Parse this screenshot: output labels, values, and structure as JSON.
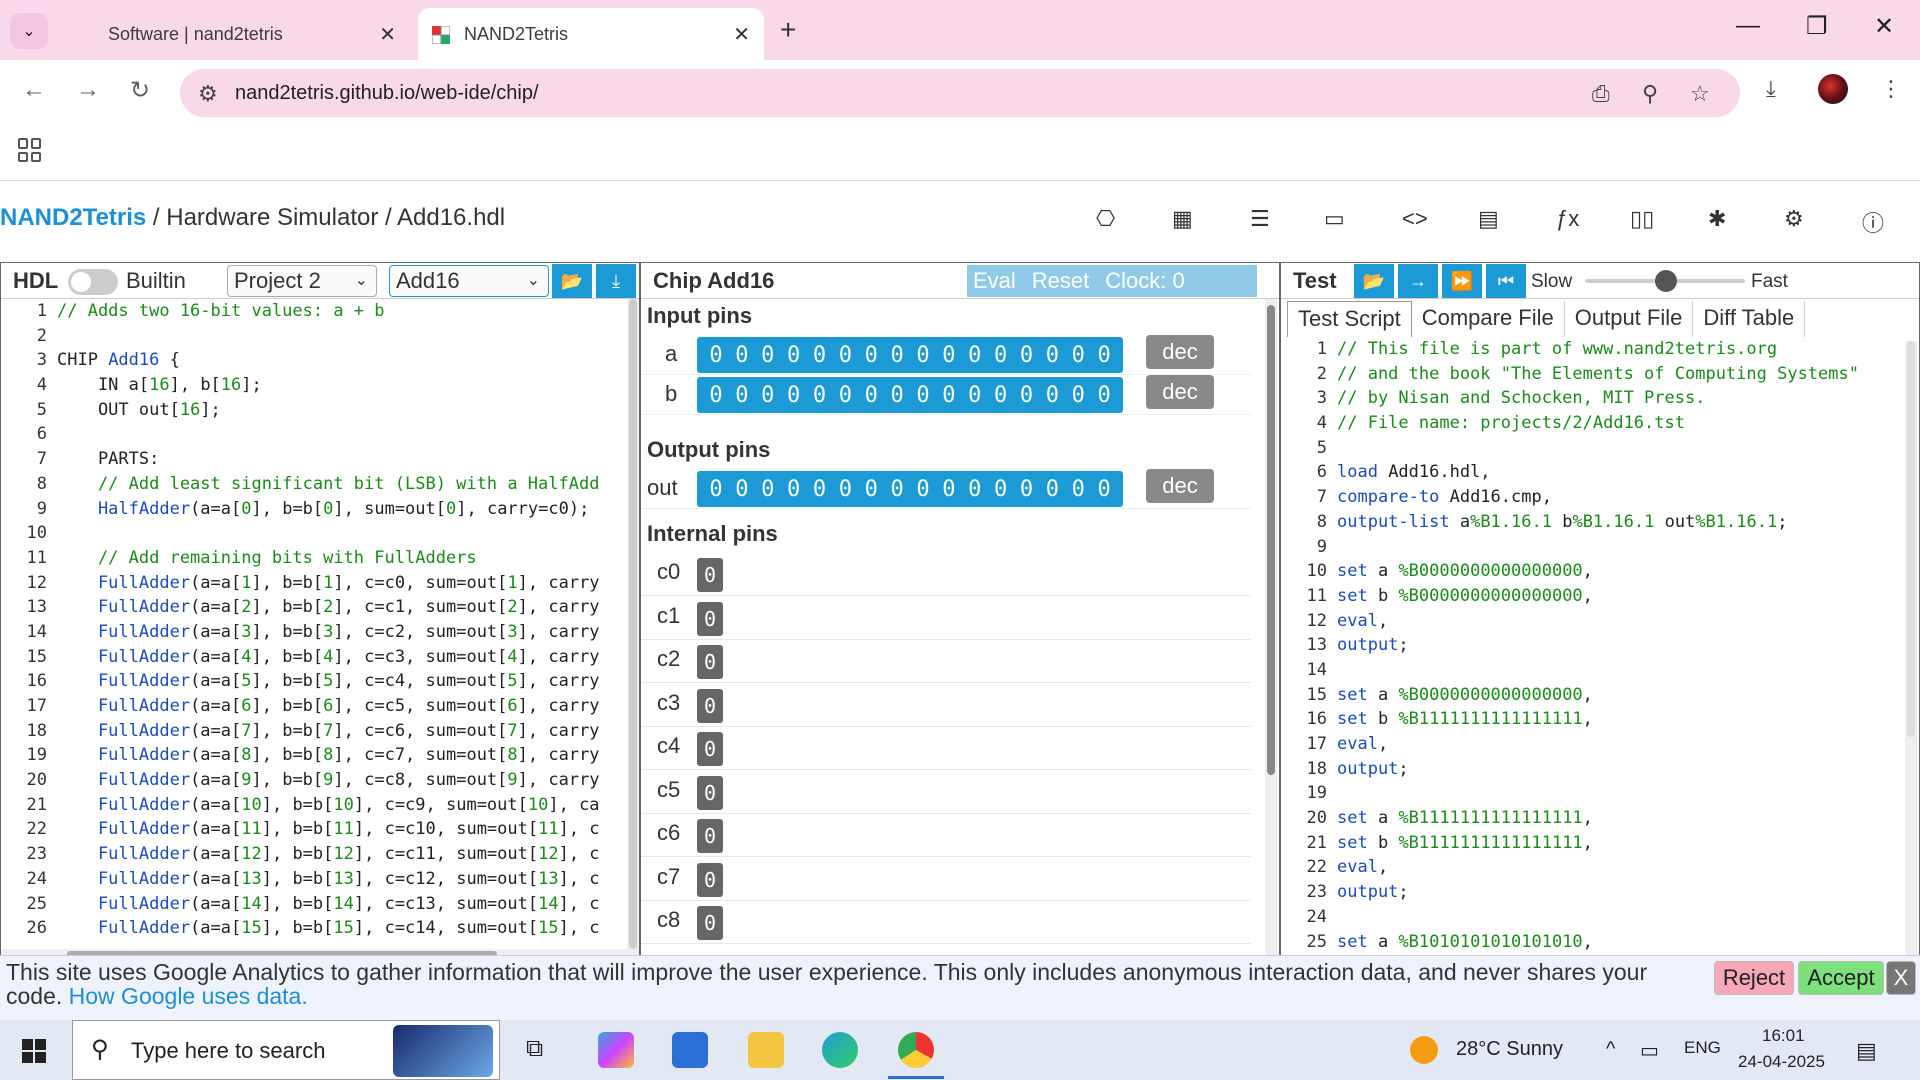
{
  "browser": {
    "tabs": [
      {
        "title": "Software | nand2tetris"
      },
      {
        "title": "NAND2Tetris"
      }
    ],
    "url": "nand2tetris.github.io/web-ide/chip/"
  },
  "app": {
    "brand": "NAND2Tetris",
    "breadcrumb_rest": " / Hardware Simulator / Add16.hdl",
    "nav_icons": [
      "chip-icon",
      "cpu-icon",
      "list-icon",
      "monitor-icon",
      "code-icon",
      "grid-icon",
      "function-icon",
      "book-icon",
      "bug-icon",
      "settings-icon",
      "info-icon"
    ]
  },
  "hdl": {
    "title": "HDL",
    "builtin_label": "Builtin",
    "project": "Project 2",
    "chip": "Add16",
    "lines": [
      [
        {
          "t": "// Adds two 16-bit values: a + b",
          "c": "cm"
        }
      ],
      [
        {
          "t": "",
          "c": "ct"
        }
      ],
      [
        {
          "t": "CHIP ",
          "c": "ct"
        },
        {
          "t": "Add16",
          "c": "kw"
        },
        {
          "t": " {",
          "c": "ct"
        }
      ],
      [
        {
          "t": "    IN a[",
          "c": "ct"
        },
        {
          "t": "16",
          "c": "nm"
        },
        {
          "t": "], b[",
          "c": "ct"
        },
        {
          "t": "16",
          "c": "nm"
        },
        {
          "t": "];",
          "c": "ct"
        }
      ],
      [
        {
          "t": "    OUT out[",
          "c": "ct"
        },
        {
          "t": "16",
          "c": "nm"
        },
        {
          "t": "];",
          "c": "ct"
        }
      ],
      [
        {
          "t": "",
          "c": "ct"
        }
      ],
      [
        {
          "t": "    PARTS:",
          "c": "ct"
        }
      ],
      [
        {
          "t": "    // Add least significant bit (LSB) with a HalfAdd",
          "c": "cm"
        }
      ],
      [
        {
          "t": "    HalfAdder",
          "c": "kw"
        },
        {
          "t": "(a=a[",
          "c": "ct"
        },
        {
          "t": "0",
          "c": "nm"
        },
        {
          "t": "], b=b[",
          "c": "ct"
        },
        {
          "t": "0",
          "c": "nm"
        },
        {
          "t": "], sum=out[",
          "c": "ct"
        },
        {
          "t": "0",
          "c": "nm"
        },
        {
          "t": "], carry=c0);",
          "c": "ct"
        }
      ],
      [
        {
          "t": "",
          "c": "ct"
        }
      ],
      [
        {
          "t": "    // Add remaining bits with FullAdders",
          "c": "cm"
        }
      ],
      [
        {
          "t": "    FullAdder",
          "c": "kw"
        },
        {
          "t": "(a=a[",
          "c": "ct"
        },
        {
          "t": "1",
          "c": "nm"
        },
        {
          "t": "], b=b[",
          "c": "ct"
        },
        {
          "t": "1",
          "c": "nm"
        },
        {
          "t": "], c=c0, sum=out[",
          "c": "ct"
        },
        {
          "t": "1",
          "c": "nm"
        },
        {
          "t": "], carry",
          "c": "ct"
        }
      ],
      [
        {
          "t": "    FullAdder",
          "c": "kw"
        },
        {
          "t": "(a=a[",
          "c": "ct"
        },
        {
          "t": "2",
          "c": "nm"
        },
        {
          "t": "], b=b[",
          "c": "ct"
        },
        {
          "t": "2",
          "c": "nm"
        },
        {
          "t": "], c=c1, sum=out[",
          "c": "ct"
        },
        {
          "t": "2",
          "c": "nm"
        },
        {
          "t": "], carry",
          "c": "ct"
        }
      ],
      [
        {
          "t": "    FullAdder",
          "c": "kw"
        },
        {
          "t": "(a=a[",
          "c": "ct"
        },
        {
          "t": "3",
          "c": "nm"
        },
        {
          "t": "], b=b[",
          "c": "ct"
        },
        {
          "t": "3",
          "c": "nm"
        },
        {
          "t": "], c=c2, sum=out[",
          "c": "ct"
        },
        {
          "t": "3",
          "c": "nm"
        },
        {
          "t": "], carry",
          "c": "ct"
        }
      ],
      [
        {
          "t": "    FullAdder",
          "c": "kw"
        },
        {
          "t": "(a=a[",
          "c": "ct"
        },
        {
          "t": "4",
          "c": "nm"
        },
        {
          "t": "], b=b[",
          "c": "ct"
        },
        {
          "t": "4",
          "c": "nm"
        },
        {
          "t": "], c=c3, sum=out[",
          "c": "ct"
        },
        {
          "t": "4",
          "c": "nm"
        },
        {
          "t": "], carry",
          "c": "ct"
        }
      ],
      [
        {
          "t": "    FullAdder",
          "c": "kw"
        },
        {
          "t": "(a=a[",
          "c": "ct"
        },
        {
          "t": "5",
          "c": "nm"
        },
        {
          "t": "], b=b[",
          "c": "ct"
        },
        {
          "t": "5",
          "c": "nm"
        },
        {
          "t": "], c=c4, sum=out[",
          "c": "ct"
        },
        {
          "t": "5",
          "c": "nm"
        },
        {
          "t": "], carry",
          "c": "ct"
        }
      ],
      [
        {
          "t": "    FullAdder",
          "c": "kw"
        },
        {
          "t": "(a=a[",
          "c": "ct"
        },
        {
          "t": "6",
          "c": "nm"
        },
        {
          "t": "], b=b[",
          "c": "ct"
        },
        {
          "t": "6",
          "c": "nm"
        },
        {
          "t": "], c=c5, sum=out[",
          "c": "ct"
        },
        {
          "t": "6",
          "c": "nm"
        },
        {
          "t": "], carry",
          "c": "ct"
        }
      ],
      [
        {
          "t": "    FullAdder",
          "c": "kw"
        },
        {
          "t": "(a=a[",
          "c": "ct"
        },
        {
          "t": "7",
          "c": "nm"
        },
        {
          "t": "], b=b[",
          "c": "ct"
        },
        {
          "t": "7",
          "c": "nm"
        },
        {
          "t": "], c=c6, sum=out[",
          "c": "ct"
        },
        {
          "t": "7",
          "c": "nm"
        },
        {
          "t": "], carry",
          "c": "ct"
        }
      ],
      [
        {
          "t": "    FullAdder",
          "c": "kw"
        },
        {
          "t": "(a=a[",
          "c": "ct"
        },
        {
          "t": "8",
          "c": "nm"
        },
        {
          "t": "], b=b[",
          "c": "ct"
        },
        {
          "t": "8",
          "c": "nm"
        },
        {
          "t": "], c=c7, sum=out[",
          "c": "ct"
        },
        {
          "t": "8",
          "c": "nm"
        },
        {
          "t": "], carry",
          "c": "ct"
        }
      ],
      [
        {
          "t": "    FullAdder",
          "c": "kw"
        },
        {
          "t": "(a=a[",
          "c": "ct"
        },
        {
          "t": "9",
          "c": "nm"
        },
        {
          "t": "], b=b[",
          "c": "ct"
        },
        {
          "t": "9",
          "c": "nm"
        },
        {
          "t": "], c=c8, sum=out[",
          "c": "ct"
        },
        {
          "t": "9",
          "c": "nm"
        },
        {
          "t": "], carry",
          "c": "ct"
        }
      ],
      [
        {
          "t": "    FullAdder",
          "c": "kw"
        },
        {
          "t": "(a=a[",
          "c": "ct"
        },
        {
          "t": "10",
          "c": "nm"
        },
        {
          "t": "], b=b[",
          "c": "ct"
        },
        {
          "t": "10",
          "c": "nm"
        },
        {
          "t": "], c=c9, sum=out[",
          "c": "ct"
        },
        {
          "t": "10",
          "c": "nm"
        },
        {
          "t": "], ca",
          "c": "ct"
        }
      ],
      [
        {
          "t": "    FullAdder",
          "c": "kw"
        },
        {
          "t": "(a=a[",
          "c": "ct"
        },
        {
          "t": "11",
          "c": "nm"
        },
        {
          "t": "], b=b[",
          "c": "ct"
        },
        {
          "t": "11",
          "c": "nm"
        },
        {
          "t": "], c=c10, sum=out[",
          "c": "ct"
        },
        {
          "t": "11",
          "c": "nm"
        },
        {
          "t": "], c",
          "c": "ct"
        }
      ],
      [
        {
          "t": "    FullAdder",
          "c": "kw"
        },
        {
          "t": "(a=a[",
          "c": "ct"
        },
        {
          "t": "12",
          "c": "nm"
        },
        {
          "t": "], b=b[",
          "c": "ct"
        },
        {
          "t": "12",
          "c": "nm"
        },
        {
          "t": "], c=c11, sum=out[",
          "c": "ct"
        },
        {
          "t": "12",
          "c": "nm"
        },
        {
          "t": "], c",
          "c": "ct"
        }
      ],
      [
        {
          "t": "    FullAdder",
          "c": "kw"
        },
        {
          "t": "(a=a[",
          "c": "ct"
        },
        {
          "t": "13",
          "c": "nm"
        },
        {
          "t": "], b=b[",
          "c": "ct"
        },
        {
          "t": "13",
          "c": "nm"
        },
        {
          "t": "], c=c12, sum=out[",
          "c": "ct"
        },
        {
          "t": "13",
          "c": "nm"
        },
        {
          "t": "], c",
          "c": "ct"
        }
      ],
      [
        {
          "t": "    FullAdder",
          "c": "kw"
        },
        {
          "t": "(a=a[",
          "c": "ct"
        },
        {
          "t": "14",
          "c": "nm"
        },
        {
          "t": "], b=b[",
          "c": "ct"
        },
        {
          "t": "14",
          "c": "nm"
        },
        {
          "t": "], c=c13, sum=out[",
          "c": "ct"
        },
        {
          "t": "14",
          "c": "nm"
        },
        {
          "t": "], c",
          "c": "ct"
        }
      ],
      [
        {
          "t": "    FullAdder",
          "c": "kw"
        },
        {
          "t": "(a=a[",
          "c": "ct"
        },
        {
          "t": "15",
          "c": "nm"
        },
        {
          "t": "], b=b[",
          "c": "ct"
        },
        {
          "t": "15",
          "c": "nm"
        },
        {
          "t": "], c=c14, sum=out[",
          "c": "ct"
        },
        {
          "t": "15",
          "c": "nm"
        },
        {
          "t": "], c",
          "c": "ct"
        }
      ]
    ]
  },
  "chip": {
    "title": "Chip Add16",
    "eval": "Eval",
    "reset": "Reset",
    "clock": "Clock: 0",
    "input_label": "Input pins",
    "output_label": "Output pins",
    "internal_label": "Internal pins",
    "dec_label": "dec",
    "inputs": [
      {
        "name": "a",
        "bits": "0000000000000000"
      },
      {
        "name": "b",
        "bits": "0000000000000000"
      }
    ],
    "outputs": [
      {
        "name": "out",
        "bits": "0000000000000000"
      }
    ],
    "internals": [
      {
        "name": "c0",
        "value": "0"
      },
      {
        "name": "c1",
        "value": "0"
      },
      {
        "name": "c2",
        "value": "0"
      },
      {
        "name": "c3",
        "value": "0"
      },
      {
        "name": "c4",
        "value": "0"
      },
      {
        "name": "c5",
        "value": "0"
      },
      {
        "name": "c6",
        "value": "0"
      },
      {
        "name": "c7",
        "value": "0"
      },
      {
        "name": "c8",
        "value": "0"
      }
    ]
  },
  "test": {
    "title": "Test",
    "slow": "Slow",
    "fast": "Fast",
    "tabs": [
      "Test Script",
      "Compare File",
      "Output File",
      "Diff Table"
    ],
    "lines": [
      [
        {
          "t": "// This file is part of www.nand2tetris.org",
          "c": "cm"
        }
      ],
      [
        {
          "t": "// and the book \"The Elements of Computing Systems\"",
          "c": "cm"
        }
      ],
      [
        {
          "t": "// by Nisan and Schocken, MIT Press.",
          "c": "cm"
        }
      ],
      [
        {
          "t": "// File name: projects/2/Add16.tst",
          "c": "cm"
        }
      ],
      [
        {
          "t": "",
          "c": "ct"
        }
      ],
      [
        {
          "t": "load",
          "c": "kw"
        },
        {
          "t": " Add16.hdl,",
          "c": "ct"
        }
      ],
      [
        {
          "t": "compare-to",
          "c": "kw"
        },
        {
          "t": " Add16.cmp,",
          "c": "ct"
        }
      ],
      [
        {
          "t": "output-list",
          "c": "kw"
        },
        {
          "t": " a",
          "c": "ct"
        },
        {
          "t": "%B1.16.1",
          "c": "nm"
        },
        {
          "t": " b",
          "c": "ct"
        },
        {
          "t": "%B1.16.1",
          "c": "nm"
        },
        {
          "t": " out",
          "c": "ct"
        },
        {
          "t": "%B1.16.1",
          "c": "nm"
        },
        {
          "t": ";",
          "c": "ct"
        }
      ],
      [
        {
          "t": "",
          "c": "ct"
        }
      ],
      [
        {
          "t": "set",
          "c": "kw"
        },
        {
          "t": " a ",
          "c": "ct"
        },
        {
          "t": "%B0000000000000000",
          "c": "nm"
        },
        {
          "t": ",",
          "c": "ct"
        }
      ],
      [
        {
          "t": "set",
          "c": "kw"
        },
        {
          "t": " b ",
          "c": "ct"
        },
        {
          "t": "%B0000000000000000",
          "c": "nm"
        },
        {
          "t": ",",
          "c": "ct"
        }
      ],
      [
        {
          "t": "eval",
          "c": "kw"
        },
        {
          "t": ",",
          "c": "ct"
        }
      ],
      [
        {
          "t": "output",
          "c": "kw"
        },
        {
          "t": ";",
          "c": "ct"
        }
      ],
      [
        {
          "t": "",
          "c": "ct"
        }
      ],
      [
        {
          "t": "set",
          "c": "kw"
        },
        {
          "t": " a ",
          "c": "ct"
        },
        {
          "t": "%B0000000000000000",
          "c": "nm"
        },
        {
          "t": ",",
          "c": "ct"
        }
      ],
      [
        {
          "t": "set",
          "c": "kw"
        },
        {
          "t": " b ",
          "c": "ct"
        },
        {
          "t": "%B1111111111111111",
          "c": "nm"
        },
        {
          "t": ",",
          "c": "ct"
        }
      ],
      [
        {
          "t": "eval",
          "c": "kw"
        },
        {
          "t": ",",
          "c": "ct"
        }
      ],
      [
        {
          "t": "output",
          "c": "kw"
        },
        {
          "t": ";",
          "c": "ct"
        }
      ],
      [
        {
          "t": "",
          "c": "ct"
        }
      ],
      [
        {
          "t": "set",
          "c": "kw"
        },
        {
          "t": " a ",
          "c": "ct"
        },
        {
          "t": "%B1111111111111111",
          "c": "nm"
        },
        {
          "t": ",",
          "c": "ct"
        }
      ],
      [
        {
          "t": "set",
          "c": "kw"
        },
        {
          "t": " b ",
          "c": "ct"
        },
        {
          "t": "%B1111111111111111",
          "c": "nm"
        },
        {
          "t": ",",
          "c": "ct"
        }
      ],
      [
        {
          "t": "eval",
          "c": "kw"
        },
        {
          "t": ",",
          "c": "ct"
        }
      ],
      [
        {
          "t": "output",
          "c": "kw"
        },
        {
          "t": ";",
          "c": "ct"
        }
      ],
      [
        {
          "t": "",
          "c": "ct"
        }
      ],
      [
        {
          "t": "set",
          "c": "kw"
        },
        {
          "t": " a ",
          "c": "ct"
        },
        {
          "t": "%B1010101010101010",
          "c": "nm"
        },
        {
          "t": ",",
          "c": "ct"
        }
      ]
    ]
  },
  "cookie": {
    "message": "This site uses Google Analytics to gather information that will improve the user experience. This only includes anonymous interaction data, and never shares your code. ",
    "link": "How Google uses data.",
    "reject": "Reject",
    "accept": "Accept",
    "close": "X"
  },
  "taskbar": {
    "search_placeholder": "Type here to search",
    "weather": "28°C  Sunny",
    "lang": "ENG",
    "time": "16:01",
    "date": "24-04-2025"
  },
  "colors": {
    "accent": "#1c9ad6",
    "chrome": "#f9d8ea",
    "accept": "#7de07d",
    "reject": "#f7a8b8"
  }
}
